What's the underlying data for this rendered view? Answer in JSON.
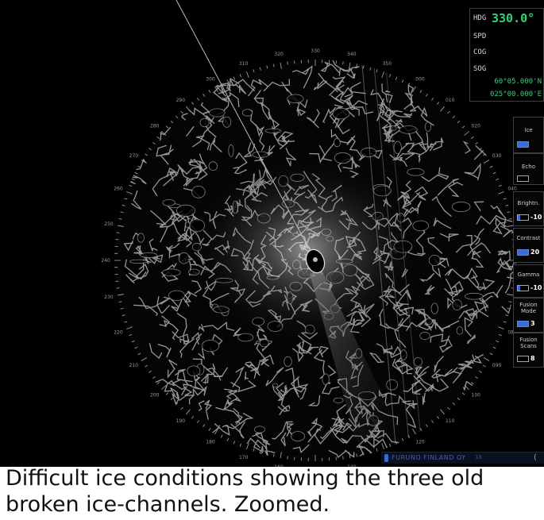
{
  "nav": {
    "hdg_label": "HDG",
    "hdg_value": "330.0°",
    "spd_label": "SPD",
    "cog_label": "COG",
    "sog_label": "SOG",
    "lat": "60°05.000'N",
    "lon": "025°00.000'E"
  },
  "panel": {
    "ice": {
      "label": "Ice"
    },
    "echo": {
      "label": "Echo"
    },
    "brightness": {
      "label": "Brightn.",
      "value": "-10"
    },
    "contrast": {
      "label": "Contrast",
      "value": "20"
    },
    "gamma": {
      "label": "Gamma",
      "value": "-10"
    },
    "fusion_mode": {
      "label": "Fusion Mode",
      "value": "3"
    },
    "fusion_scans": {
      "label": "Fusion Scans",
      "value": "8"
    }
  },
  "bearing_labels": [
    "000",
    "010",
    "020",
    "030",
    "040",
    "050",
    "060",
    "070",
    "080",
    "090",
    "100",
    "110",
    "120",
    "130",
    "140",
    "150",
    "160",
    "170",
    "180",
    "190",
    "200",
    "210",
    "220",
    "230",
    "240",
    "250",
    "260",
    "270",
    "280",
    "290",
    "300",
    "310",
    "320",
    "330",
    "340",
    "350"
  ],
  "brand": {
    "text": "FURUNO FINLAND OY",
    "sub": "18"
  },
  "colors": {
    "accent_green": "#2fd37a",
    "panel_blue": "#3a6bd6",
    "radar_echo": "#c8c8c8"
  },
  "caption": "Difficult ice conditions showing the three old broken ice-channels. Zoomed."
}
